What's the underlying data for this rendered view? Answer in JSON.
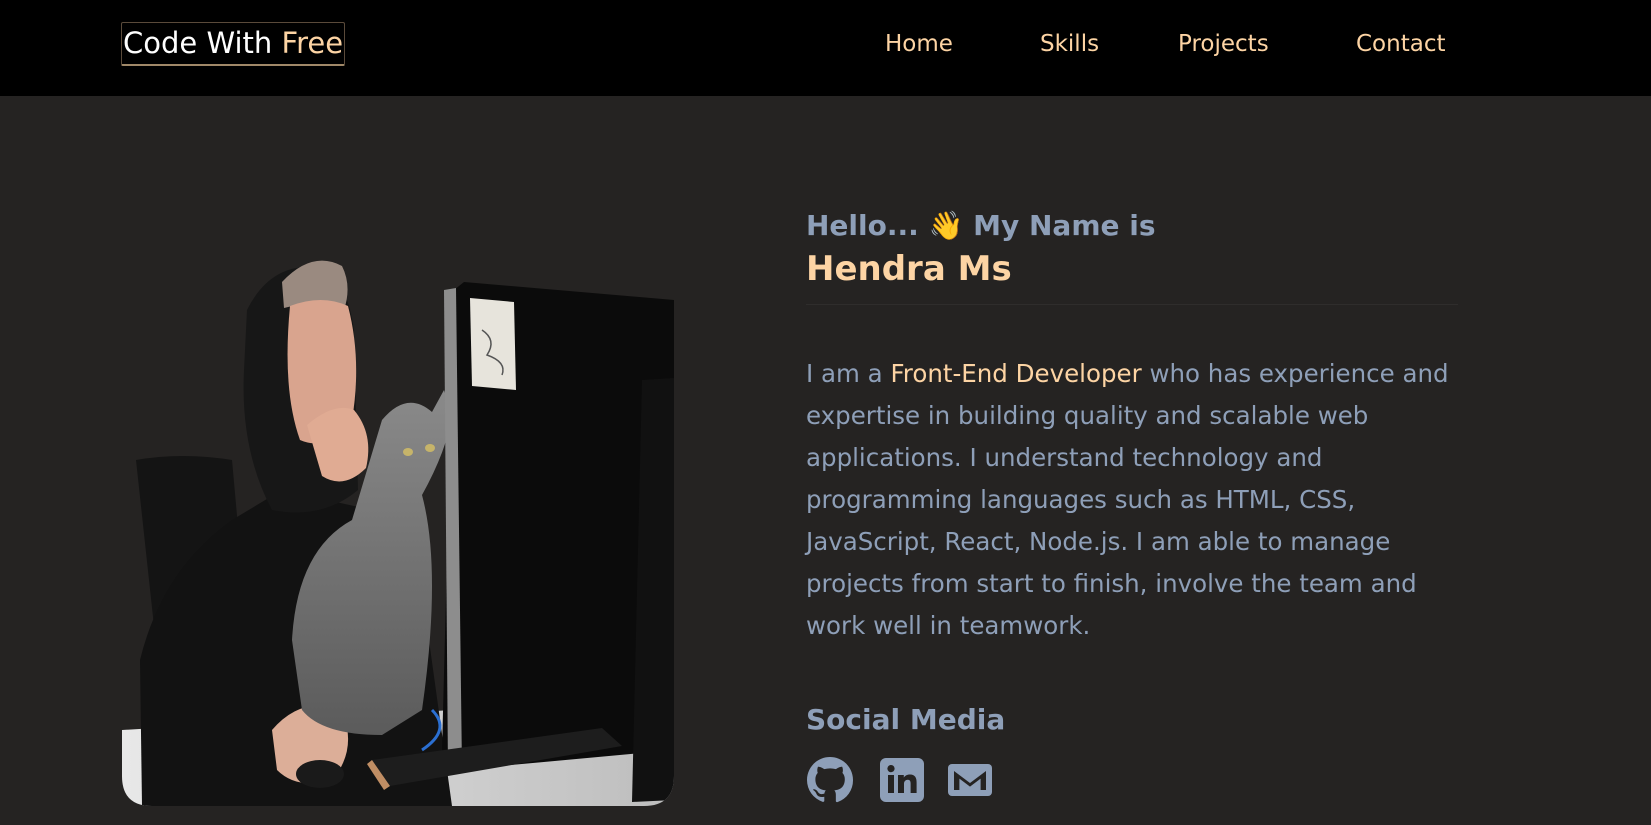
{
  "navbar": {
    "logo": {
      "text_main": "Code With ",
      "text_accent": "Free"
    },
    "links": [
      {
        "label": "Home"
      },
      {
        "label": "Skills"
      },
      {
        "label": "Projects"
      },
      {
        "label": "Contact"
      }
    ]
  },
  "hero": {
    "greeting": "Hello... 👋 My Name is",
    "name": "Hendra Ms",
    "bio": {
      "before": "I am a ",
      "highlight": "Front-End Developer",
      "after": " who has experience and expertise in building quality and scalable web applications. I understand technology and programming languages such as HTML, CSS, JavaScript, React, Node.js. I am able to manage projects from start to finish, involve the team and work well in teamwork."
    },
    "image_icon": "developer-with-cat-photo"
  },
  "social": {
    "heading": "Social Media",
    "icons": [
      {
        "name": "github-icon"
      },
      {
        "name": "linkedin-icon"
      },
      {
        "name": "mail-icon"
      }
    ]
  },
  "colors": {
    "background": "#252322",
    "navbar": "#000000",
    "accent": "#fdd4a4",
    "muted_text": "#8e9fb8",
    "white": "#ffffff"
  }
}
